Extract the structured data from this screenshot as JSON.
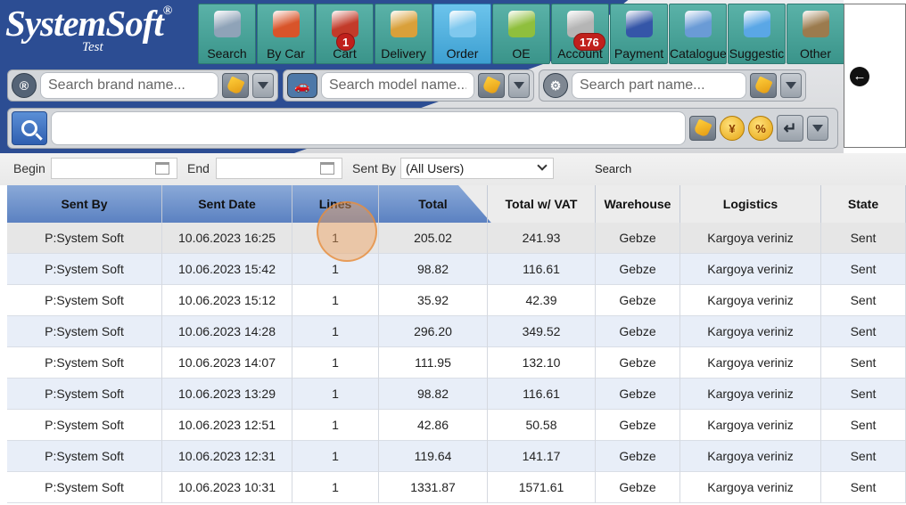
{
  "logo": {
    "name": "SystemSoft",
    "reg": "®",
    "subtitle": "Test"
  },
  "toolbar": [
    {
      "label": "Search",
      "icon": "magnifier-icon",
      "color": "#8fa3b8"
    },
    {
      "label": "By Car",
      "icon": "car-wrench-icon",
      "color": "#d8542a"
    },
    {
      "label": "Cart",
      "icon": "cart-icon",
      "color": "#c23b2a",
      "badge": "1"
    },
    {
      "label": "Delivery",
      "icon": "delivery-box-icon",
      "color": "#d9a03a"
    },
    {
      "label": "Order",
      "icon": "order-folder-icon",
      "color": "#7fc8ee",
      "active": true
    },
    {
      "label": "OE",
      "icon": "oe-tag-icon",
      "color": "#8fbf3d"
    },
    {
      "label": "Account",
      "icon": "cash-register-icon",
      "color": "#b5b5b5",
      "badge": "176"
    },
    {
      "label": "Payment",
      "icon": "card-terminal-icon",
      "color": "#3556a8"
    },
    {
      "label": "Catalogue",
      "icon": "catalogue-book-icon",
      "color": "#6a9bd6"
    },
    {
      "label": "Suggestic",
      "icon": "chat-bubble-icon",
      "color": "#5aa7e6"
    },
    {
      "label": "Other",
      "icon": "toolbox-icon",
      "color": "#9b7b4e"
    }
  ],
  "search": {
    "brand_placeholder": "Search brand name...",
    "model_placeholder": "Search model name...",
    "part_placeholder": "Search part name...",
    "brand_icon_text": "®",
    "coin1": "¥",
    "coin2": "%",
    "enter_glyph": "↵"
  },
  "side_panel": {
    "back_glyph": "←"
  },
  "filter": {
    "begin_label": "Begin",
    "end_label": "End",
    "sent_by_label": "Sent By",
    "sent_by_value": "(All Users)",
    "search_label": "Search"
  },
  "table": {
    "columns": [
      "Sent By",
      "Sent Date",
      "Lines",
      "Total",
      "Total w/ VAT",
      "Warehouse",
      "Logistics",
      "State"
    ],
    "rows": [
      [
        "P:System Soft",
        "10.06.2023 16:25",
        "1",
        "205.02",
        "241.93",
        "Gebze",
        "Kargoya veriniz",
        "Sent"
      ],
      [
        "P:System Soft",
        "10.06.2023 15:42",
        "1",
        "98.82",
        "116.61",
        "Gebze",
        "Kargoya veriniz",
        "Sent"
      ],
      [
        "P:System Soft",
        "10.06.2023 15:12",
        "1",
        "35.92",
        "42.39",
        "Gebze",
        "Kargoya veriniz",
        "Sent"
      ],
      [
        "P:System Soft",
        "10.06.2023 14:28",
        "1",
        "296.20",
        "349.52",
        "Gebze",
        "Kargoya veriniz",
        "Sent"
      ],
      [
        "P:System Soft",
        "10.06.2023 14:07",
        "1",
        "111.95",
        "132.10",
        "Gebze",
        "Kargoya veriniz",
        "Sent"
      ],
      [
        "P:System Soft",
        "10.06.2023 13:29",
        "1",
        "98.82",
        "116.61",
        "Gebze",
        "Kargoya veriniz",
        "Sent"
      ],
      [
        "P:System Soft",
        "10.06.2023 12:51",
        "1",
        "42.86",
        "50.58",
        "Gebze",
        "Kargoya veriniz",
        "Sent"
      ],
      [
        "P:System Soft",
        "10.06.2023 12:31",
        "1",
        "119.64",
        "141.17",
        "Gebze",
        "Kargoya veriniz",
        "Sent"
      ],
      [
        "P:System Soft",
        "10.06.2023 10:31",
        "1",
        "1331.87",
        "1571.61",
        "Gebze",
        "Kargoya veriniz",
        "Sent"
      ]
    ]
  }
}
